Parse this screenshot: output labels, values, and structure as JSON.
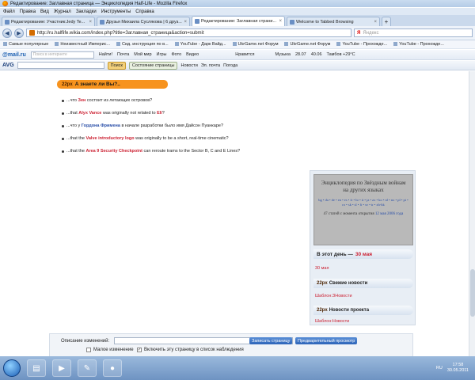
{
  "window": {
    "title": "Редактирование: Заглавная страница — Энциклопедия Half-Life - Mozilla Firefox"
  },
  "menu": [
    "Файл",
    "Правка",
    "Вид",
    "Журнал",
    "Закладки",
    "Инструменты",
    "Справка"
  ],
  "tabs": [
    {
      "label": "Редактирование: Участник:Jedy Te...",
      "active": false
    },
    {
      "label": "Друзья Михаила Суслякова | 6 друз...",
      "active": false
    },
    {
      "label": "Редактирование: Заглавная страни...",
      "active": true
    },
    {
      "label": "Welcome to Tabbed Browsing",
      "active": false
    }
  ],
  "nav": {
    "url": "http://ru.halflife.wikia.com/index.php?title=Заглавная_страница&action=submit",
    "search_placeholder": "Яндекс"
  },
  "bookmarks": [
    "Самые популярные",
    "Неизвестный Империс...",
    "Сид. инструкция по в...",
    "YouTube - Дарк Вайд...",
    "UkrGame.net Форум",
    "UkrGame.net Форум",
    "YouTube - Прохожде...",
    "YouTube - Прохожде..."
  ],
  "mailru": {
    "logo": "@mail.ru",
    "search_placeholder": "Поиск в интернете",
    "find": "Найти!",
    "items": [
      "Почта",
      "Мой мир",
      "Игры",
      "Фото",
      "Видео",
      "Нравится",
      "Музыка",
      "28.07",
      "40.06",
      "Тамбов +29°C"
    ]
  },
  "avg": {
    "logo": "AVG",
    "search_btn": "Поиск",
    "status_btn": "Состояние страницы",
    "items": [
      "Новости",
      "Эл. почта",
      "Погода"
    ]
  },
  "page": {
    "did_you_know": {
      "px": "22px",
      "title": "А знаете ли Вы?.."
    },
    "facts": [
      {
        "pre": "...что",
        "link": "Зен",
        "link_color": "red",
        "post": "состоит из летающих островов?"
      },
      {
        "pre": "...that",
        "link": "Alyx Vance",
        "link_color": "red",
        "post": "was originally not related to",
        "link2": "Eli",
        "post2": "?"
      },
      {
        "pre": "...что у",
        "link": "Гордона Фримена",
        "link_color": "blue",
        "post": "в начале разработки было имя Дайсон Пуанкаре?"
      },
      {
        "pre": "...that the",
        "link": "Valve introductory logo",
        "link_color": "red",
        "post": "was originally to be a short, real-time cinematic?"
      },
      {
        "pre": "...that the",
        "link": "Area 9 Security Checkpoint",
        "link_color": "red",
        "post": "can reroute trams to the Sector B, C and E Lines?"
      }
    ],
    "wiki_box": {
      "heading": "Энциклопедия по Звёздным войнам\nна других языках",
      "langs": "bg • da • de • en • es • fr • hr • it • ja • zo • ko • nl • no • pl • pt • ro • sk • sl • fi • sv • tr • zh-hk",
      "count_text": "47 статей с момента открытия",
      "date": "12 мая 2006 года"
    },
    "this_day": {
      "label": "В этот день —",
      "date": "30 мая",
      "link": "30 мая"
    },
    "news": {
      "px": "22px",
      "title": "Свежие новости",
      "link": "Шаблон:ЗНовости"
    },
    "project_news": {
      "px": "22px",
      "title": "Новости проекта",
      "link": "Шаблон:Новости"
    }
  },
  "edit": {
    "summary_label": "Описание изменений:",
    "save_btn": "Записать страницу",
    "preview_btn": "Предварительный просмотр",
    "minor_label": "Малое изменение",
    "watch_label": "Включить эту страницу в список наблюдения",
    "watch_checked": true
  },
  "taskbar": {
    "lang": "RU",
    "time": "17:58",
    "date": "30.05.2011"
  }
}
